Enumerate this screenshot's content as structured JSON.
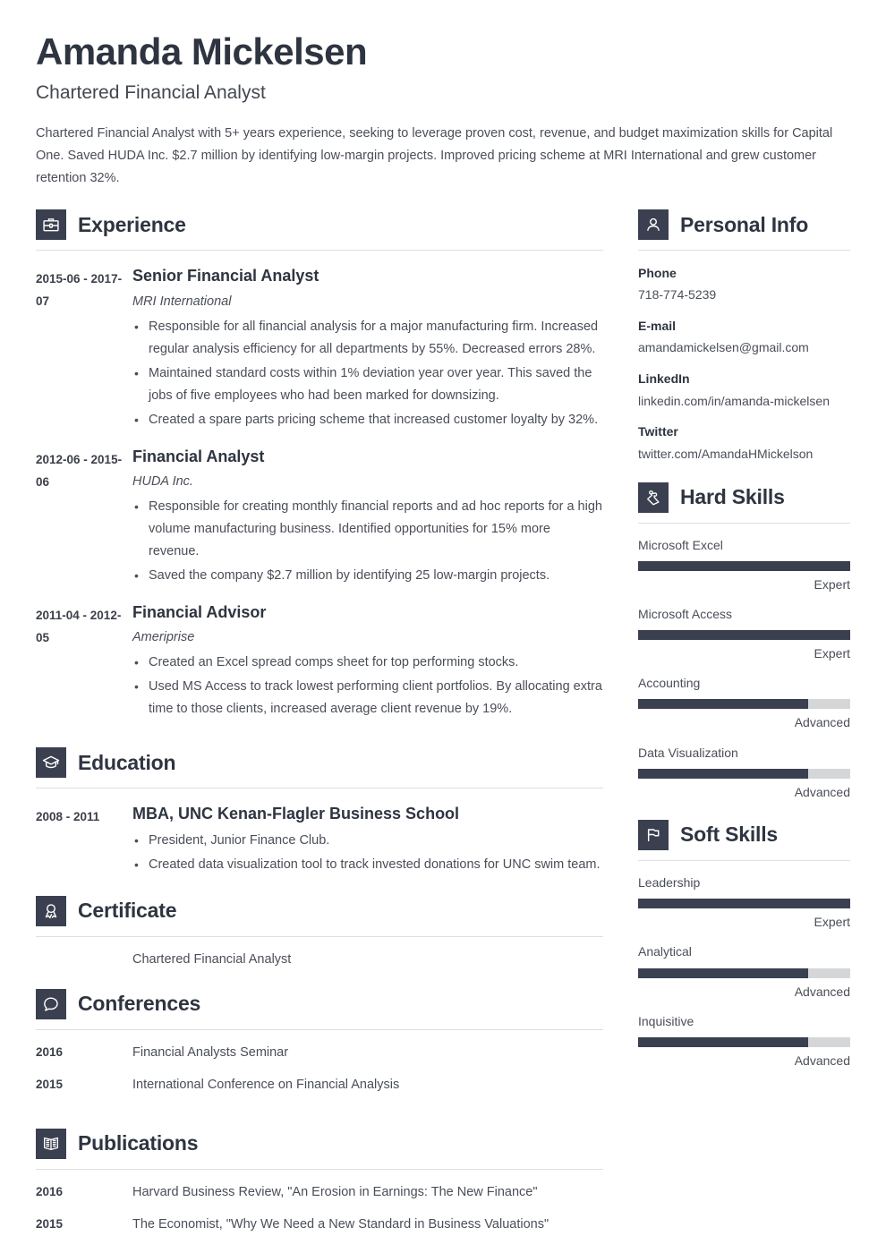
{
  "header": {
    "full_name": "Amanda Mickelsen",
    "job_title": "Chartered Financial Analyst",
    "summary": "Chartered Financial Analyst with 5+ years experience, seeking to leverage proven cost, revenue, and budget maximization skills for Capital One. Saved HUDA Inc. $2.7 million by identifying low-margin projects. Improved pricing scheme at MRI International and grew customer retention 32%."
  },
  "theme": {
    "accent_dark": "#3a4050",
    "text": "#4a4e57",
    "heading": "#2e3440",
    "rule": "#dedfe2",
    "track": "#d4d6d8"
  },
  "sections": {
    "experience": {
      "title": "Experience",
      "icon": "briefcase-icon",
      "entries": [
        {
          "date": "2015-06 - 2017-07",
          "title": "Senior Financial Analyst",
          "org": "MRI International",
          "bullets": [
            "Responsible for all financial analysis for a major manufacturing firm. Increased regular analysis efficiency for all departments by 55%. Decreased errors 28%.",
            "Maintained standard costs within 1% deviation year over year. This saved the jobs of five employees who had been marked for downsizing.",
            "Created a spare parts pricing scheme that increased customer loyalty by 32%."
          ]
        },
        {
          "date": "2012-06 - 2015-06",
          "title": "Financial Analyst",
          "org": "HUDA Inc.",
          "bullets": [
            "Responsible for creating monthly financial reports and ad hoc reports for a high volume manufacturing business. Identified opportunities for 15% more revenue.",
            "Saved the company $2.7 million by identifying 25 low-margin projects."
          ]
        },
        {
          "date": "2011-04 - 2012-05",
          "title": "Financial Advisor",
          "org": "Ameriprise",
          "bullets": [
            "Created an Excel spread comps sheet for top performing stocks.",
            "Used MS Access to track lowest performing client portfolios. By allocating extra time to those clients, increased average client revenue by 19%."
          ]
        }
      ]
    },
    "education": {
      "title": "Education",
      "icon": "graduation-cap-icon",
      "entries": [
        {
          "date": "2008 - 2011",
          "title": "MBA, UNC Kenan-Flagler Business School",
          "org": "",
          "bullets": [
            "President, Junior Finance Club.",
            "Created data visualization tool to track invested donations for UNC swim team."
          ]
        }
      ]
    },
    "certificate": {
      "title": "Certificate",
      "icon": "award-medal-icon",
      "items": [
        {
          "year": "",
          "text": "Chartered Financial Analyst"
        }
      ]
    },
    "conferences": {
      "title": "Conferences",
      "icon": "speech-bubble-icon",
      "items": [
        {
          "year": "2016",
          "text": "Financial Analysts Seminar"
        },
        {
          "year": "2015",
          "text": "International Conference on Financial Analysis"
        }
      ]
    },
    "publications": {
      "title": "Publications",
      "icon": "open-book-icon",
      "items": [
        {
          "year": "2016",
          "text": "Harvard Business Review, \"An Erosion in Earnings: The New Finance\""
        },
        {
          "year": "2015",
          "text": "The Economist, \"Why We Need a New Standard in Business Valuations\""
        }
      ]
    },
    "personal_info": {
      "title": "Personal Info",
      "icon": "person-icon",
      "fields": [
        {
          "label": "Phone",
          "value": "718-774-5239"
        },
        {
          "label": "E-mail",
          "value": "amandamickelsen@gmail.com"
        },
        {
          "label": "LinkedIn",
          "value": "linkedin.com/in/amanda-mickelsen"
        },
        {
          "label": "Twitter",
          "value": "twitter.com/AmandaHMickelson"
        }
      ]
    },
    "hard_skills": {
      "title": "Hard Skills",
      "icon": "puzzle-piece-icon",
      "skills": [
        {
          "name": "Microsoft Excel",
          "level": "Expert",
          "percent": 100
        },
        {
          "name": "Microsoft Access",
          "level": "Expert",
          "percent": 100
        },
        {
          "name": "Accounting",
          "level": "Advanced",
          "percent": 80
        },
        {
          "name": "Data Visualization",
          "level": "Advanced",
          "percent": 80
        }
      ]
    },
    "soft_skills": {
      "title": "Soft Skills",
      "icon": "flag-icon",
      "skills": [
        {
          "name": "Leadership",
          "level": "Expert",
          "percent": 100
        },
        {
          "name": "Analytical",
          "level": "Advanced",
          "percent": 80
        },
        {
          "name": "Inquisitive",
          "level": "Advanced",
          "percent": 80
        }
      ]
    }
  }
}
